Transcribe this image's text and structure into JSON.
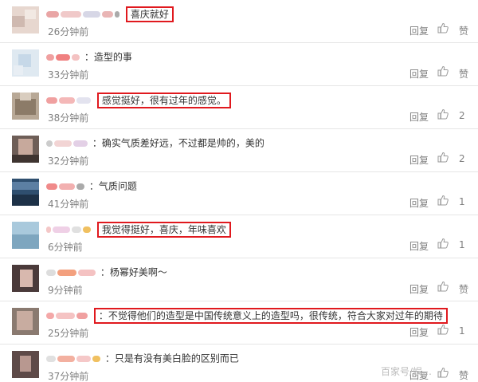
{
  "comments": [
    {
      "text": "喜庆就好",
      "highlighted": true,
      "time": "26分钟前",
      "reply": "回复",
      "likes": "赞"
    },
    {
      "text": "：造型的事",
      "highlighted": false,
      "time": "33分钟前",
      "reply": "回复",
      "likes": "赞"
    },
    {
      "text": "感觉挺好，很有过年的感觉。",
      "highlighted": true,
      "time": "38分钟前",
      "reply": "回复",
      "likes": "2"
    },
    {
      "text": "：确实气质差好远，不过都是帅的，美的",
      "highlighted": false,
      "time": "32分钟前",
      "reply": "回复",
      "likes": "2"
    },
    {
      "text": "：气质问题",
      "highlighted": false,
      "time": "41分钟前",
      "reply": "回复",
      "likes": "1"
    },
    {
      "text": "我觉得挺好，喜庆，年味喜欢",
      "highlighted": true,
      "time": "6分钟前",
      "reply": "回复",
      "likes": "1"
    },
    {
      "text": "：杨幂好美啊～",
      "highlighted": false,
      "time": "9分钟前",
      "reply": "回复",
      "likes": "赞"
    },
    {
      "text": "：不觉得他们的造型是中国传统意义上的造型吗，很传统，符合大家对过年的期待",
      "highlighted": true,
      "time": "25分钟前",
      "reply": "回复",
      "likes": "1"
    },
    {
      "text": "：只是有没有美白脸的区别而已",
      "highlighted": false,
      "time": "37分钟前",
      "reply": "回复",
      "likes": "赞"
    }
  ],
  "watermark": "百家号/娱…"
}
